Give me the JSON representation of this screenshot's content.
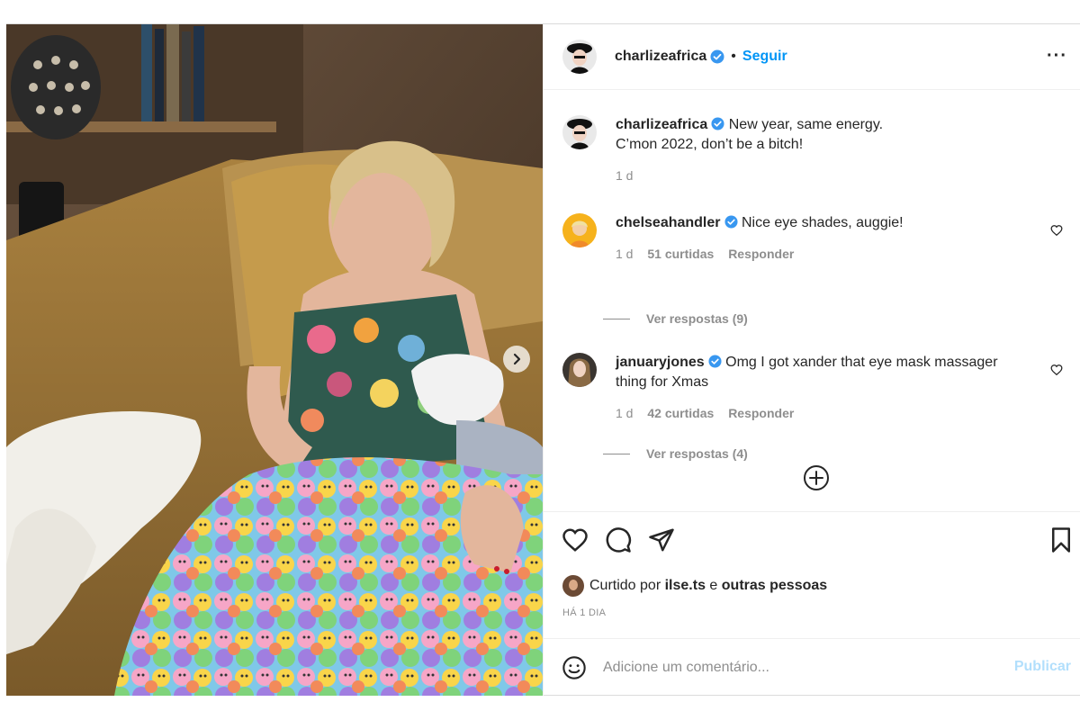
{
  "post": {
    "author": "charlizeafrica",
    "follow_label": "Seguir",
    "dot": "•",
    "more_label": "···"
  },
  "comments": [
    {
      "user": "charlizeafrica",
      "verified": true,
      "text_line1": "New year, same energy.",
      "text_line2": "C’mon 2022, don’t be a bitch!",
      "time": "1 d"
    },
    {
      "user": "chelseahandler",
      "verified": true,
      "text": "Nice eye shades, auggie!",
      "time": "1 d",
      "likes": "51 curtidas",
      "reply": "Responder",
      "view_replies": "Ver respostas (9)"
    },
    {
      "user": "januaryjones",
      "verified": true,
      "text_line1": "Omg I got xander that eye mask massager",
      "text_line2": "thing for Xmas",
      "time": "1 d",
      "likes": "42 curtidas",
      "reply": "Responder",
      "view_replies": "Ver respostas (4)"
    }
  ],
  "likes": {
    "prefix": "Curtido por",
    "user": "ilse.ts",
    "conj": "e",
    "others": "outras pessoas"
  },
  "timestamp": "HÁ 1 DIA",
  "composer": {
    "placeholder": "Adicione um comentário...",
    "publish_label": "Publicar"
  },
  "icons": {
    "post_image": "photo-woman-sleeping-couch",
    "next": "chevron-right-icon",
    "verified": "verified-badge-icon",
    "like": "heart-icon",
    "comment": "comment-icon",
    "share": "share-icon",
    "save": "bookmark-icon",
    "emoji": "emoji-icon",
    "load_more": "plus-circle-icon"
  },
  "colors": {
    "accent": "#0095f6",
    "verified": "#3897f0",
    "muted": "#8e8e8e",
    "publish_disabled": "#b2dffc"
  }
}
